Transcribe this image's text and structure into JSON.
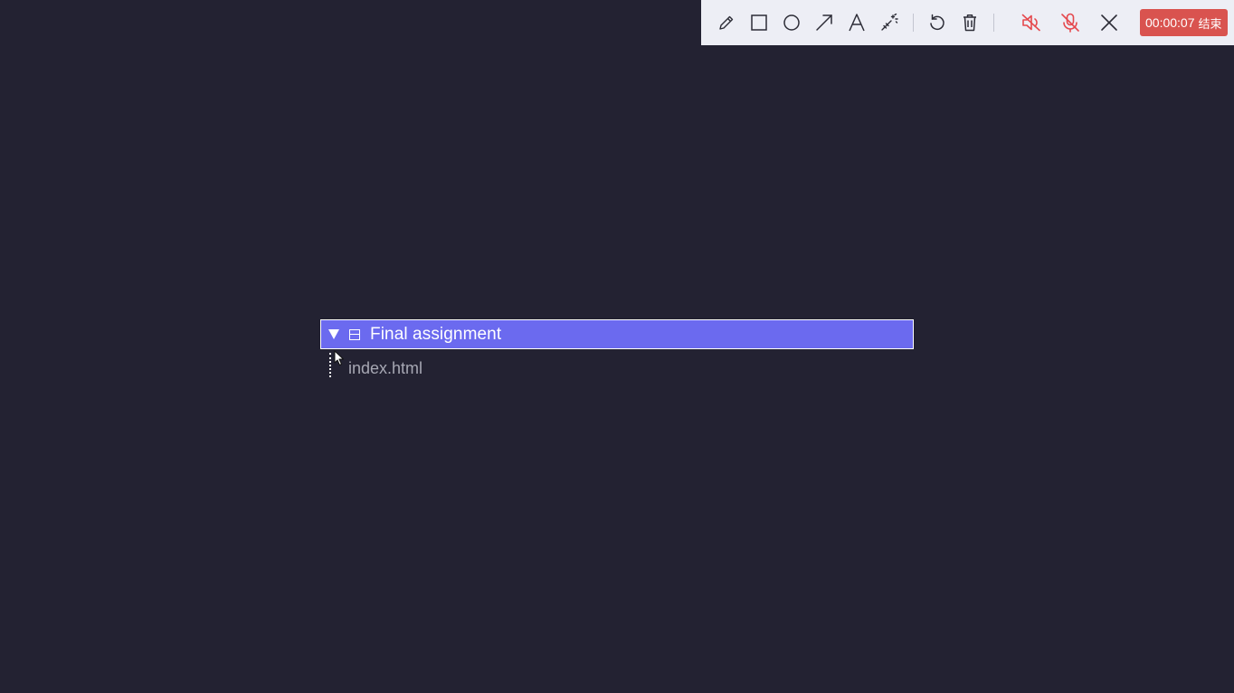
{
  "toolbar": {
    "tools": [
      {
        "name": "pencil-icon"
      },
      {
        "name": "rectangle-icon"
      },
      {
        "name": "circle-icon"
      },
      {
        "name": "arrow-icon"
      },
      {
        "name": "text-icon"
      },
      {
        "name": "magic-wand-icon"
      },
      {
        "name": "undo-icon"
      },
      {
        "name": "trash-icon"
      },
      {
        "name": "speaker-muted-icon"
      },
      {
        "name": "mic-muted-icon"
      },
      {
        "name": "close-icon"
      }
    ],
    "timer": "00:00:07",
    "end_label": "结束",
    "icon_color": "#2c2c36",
    "muted_color": "#e5484d",
    "timer_color": "#d9534f"
  },
  "tree": {
    "folder_label": "Final assignment",
    "file_label": "index.html",
    "selection_color": "#6b6aef"
  },
  "background_color": "#232232"
}
